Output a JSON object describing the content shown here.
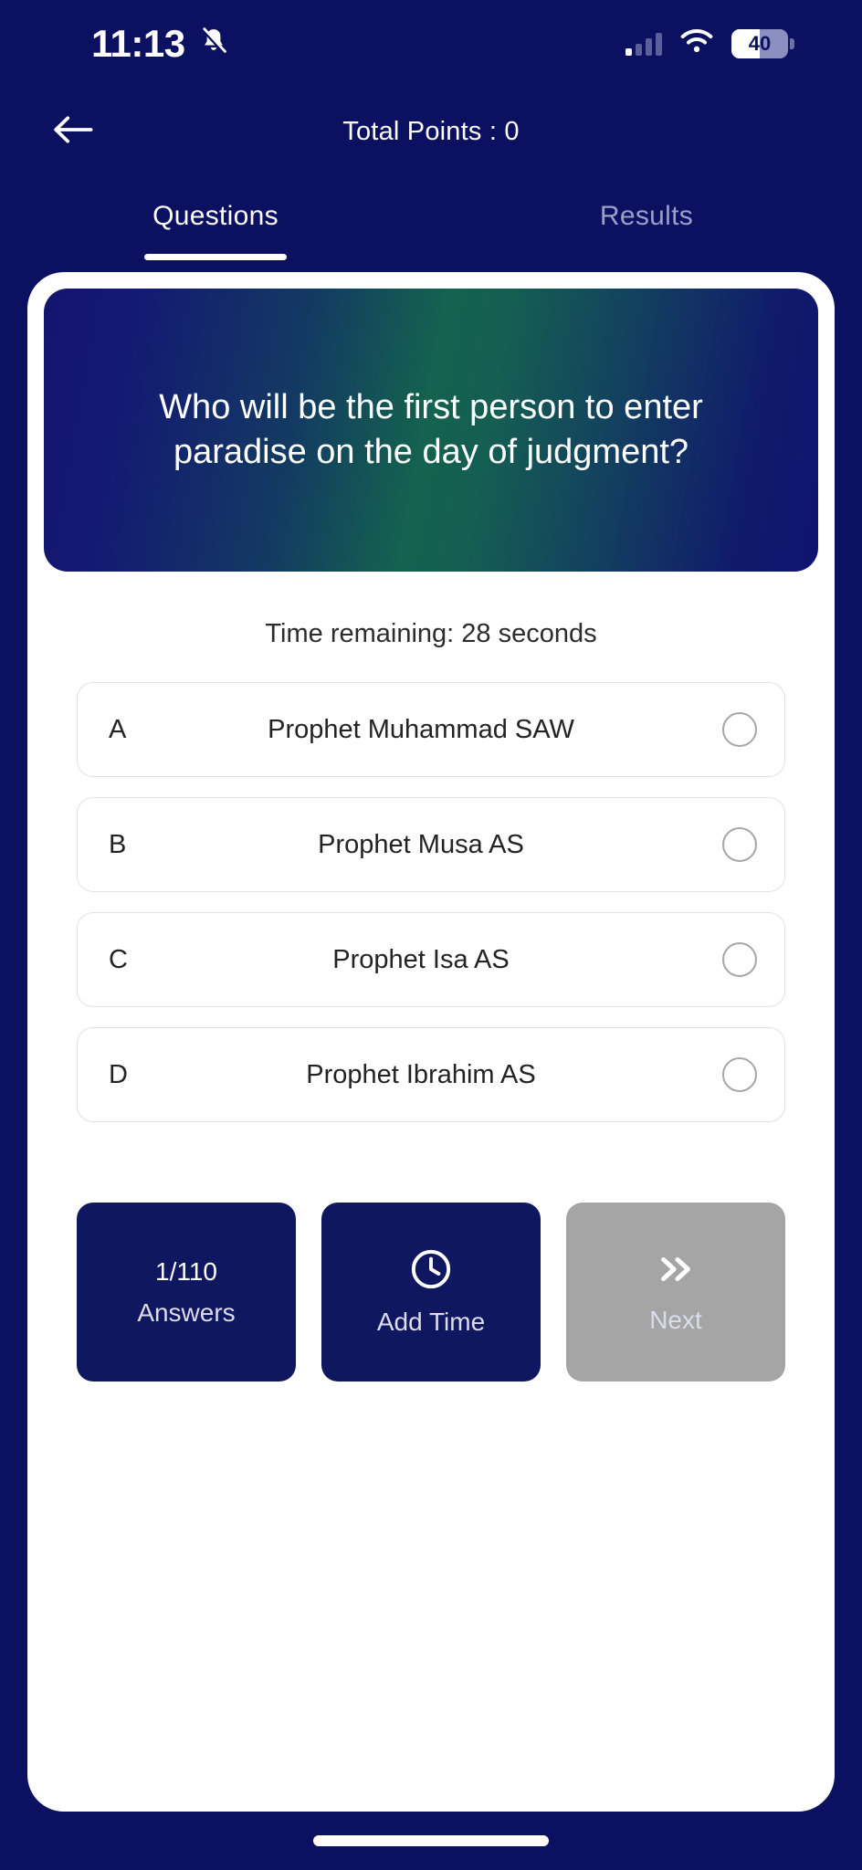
{
  "theme": {
    "bg_navy": "#0c1060",
    "card_navy": "#0f1760",
    "gradient_teal": "#14624f",
    "disabled_gray": "#a5a5a5",
    "sheet_white": "#ffffff"
  },
  "status_bar": {
    "time": "11:13",
    "bell_icon": "bell-muted-icon",
    "signal_icon": "cellular-signal-icon",
    "wifi_icon": "wifi-icon",
    "battery_percent": "40",
    "battery_icon": "battery-icon"
  },
  "header": {
    "back_icon": "arrow-left-icon",
    "title": "Total Points : 0"
  },
  "tabs": [
    {
      "label": "Questions",
      "active": true
    },
    {
      "label": "Results",
      "active": false
    }
  ],
  "question": {
    "text": "Who will be the first person to enter paradise on the day of judgment?",
    "time_remaining": "Time remaining: 28 seconds"
  },
  "options": [
    {
      "letter": "A",
      "text": "Prophet Muhammad SAW",
      "selected": false
    },
    {
      "letter": "B",
      "text": "Prophet Musa AS",
      "selected": false
    },
    {
      "letter": "C",
      "text": "Prophet Isa AS",
      "selected": false
    },
    {
      "letter": "D",
      "text": "Prophet Ibrahim AS",
      "selected": false
    }
  ],
  "buttons": {
    "answers": {
      "line1": "1/110",
      "line2": "Answers"
    },
    "add_time": {
      "icon": "clock-icon",
      "label": "Add Time"
    },
    "next": {
      "icon": "double-chevron-right-icon",
      "label": "Next",
      "disabled": true
    }
  }
}
